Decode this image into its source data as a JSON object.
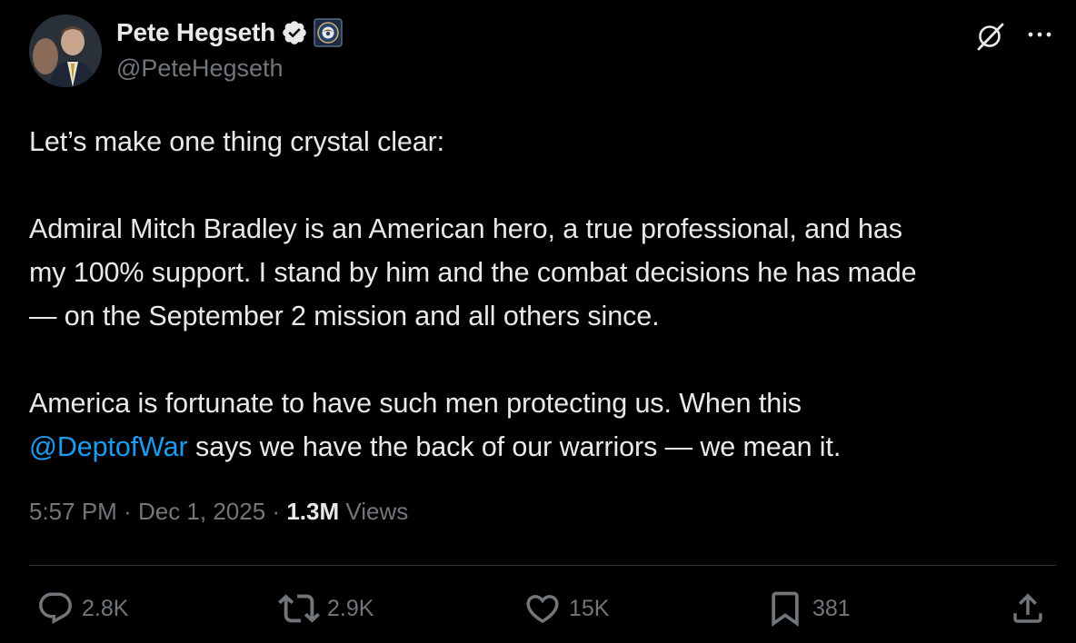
{
  "author": {
    "display_name": "Pete Hegseth",
    "handle": "@PeteHegseth",
    "verified": true,
    "affiliation_badge": "department-seal-icon"
  },
  "header_actions": {
    "grok_icon": "grok-icon",
    "more_icon": "more-icon"
  },
  "post": {
    "line1": "Let’s make one thing crystal clear:",
    "para2_line1": "Admiral Mitch Bradley is an American hero, a true professional, and has",
    "para2_line2": "my 100% support. I stand by him and the combat decisions he has made",
    "para2_line3": "— on the September 2 mission and all others since.",
    "para3_line1": "America is fortunate to have such men protecting us. When this",
    "para3_mention": "@DeptofWar",
    "para3_line2_rest": " says we have the back of our warriors — we mean it."
  },
  "meta": {
    "time": "5:57 PM",
    "separator": "·",
    "date": "Dec 1, 2025",
    "views_count": "1.3M",
    "views_label": "Views"
  },
  "actions": {
    "replies": "2.8K",
    "reposts": "2.9K",
    "likes": "15K",
    "bookmarks": "381"
  },
  "colors": {
    "background": "#000000",
    "text": "#e7e9ea",
    "secondary": "#71767b",
    "link": "#1d9bf0",
    "divider": "#2f3336",
    "verified": "#e7e9ea"
  }
}
